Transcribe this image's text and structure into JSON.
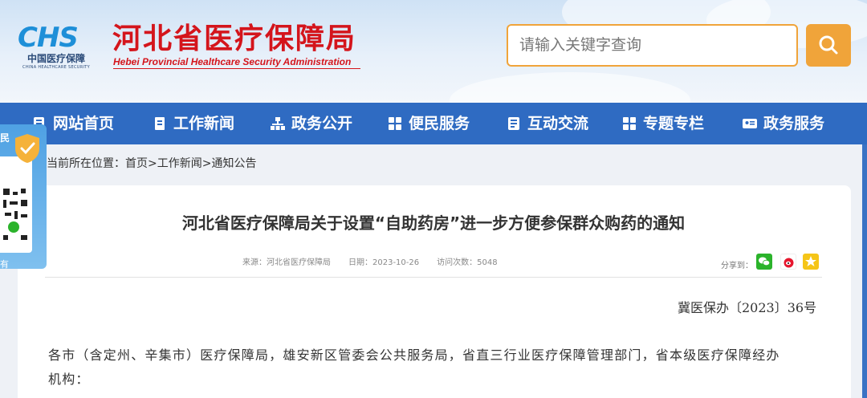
{
  "header": {
    "logo_letters": "CHS",
    "logo_cn": "中国医疗保障",
    "logo_en": "CHINA HEALTHCARE SECURITY",
    "site_title_cn": "河北省医疗保障局",
    "site_title_en": "Hebei Provincial Healthcare Security Administration",
    "search_placeholder": "请输入关键字查询",
    "search_icon": "search-icon"
  },
  "nav": {
    "items": [
      {
        "label": "网站首页",
        "icon": "book-icon"
      },
      {
        "label": "工作新闻",
        "icon": "bookmark-icon"
      },
      {
        "label": "政务公开",
        "icon": "sitemap-icon"
      },
      {
        "label": "便民服务",
        "icon": "grid-icon"
      },
      {
        "label": "互动交流",
        "icon": "document-icon"
      },
      {
        "label": "专题专栏",
        "icon": "grid-icon"
      },
      {
        "label": "政务服务",
        "icon": "id-card-icon"
      }
    ]
  },
  "breadcrumb": {
    "prefix": "当前所在位置：",
    "items": [
      "首页",
      "工作新闻",
      "通知公告"
    ],
    "separator": ">"
  },
  "article": {
    "title": "河北省医疗保障局关于设置“自助药房”进一步方便参保群众购药的通知",
    "source_label": "来源：",
    "source": "河北省医疗保障局",
    "date_label": "日期：",
    "date": "2023-10-26",
    "views_label": "访问次数：",
    "views": "5048",
    "share_label": "分享到：",
    "share_icons": [
      "wechat-icon",
      "weibo-icon",
      "qzone-icon"
    ],
    "doc_number": "冀医保办〔2023〕36号",
    "body_line1": "各市（含定州、辛集市）医疗保障局，雄安新区管委会公共服务局，省直三行业医疗保障管理部门，省本级医疗保障经办",
    "body_line2": "机构："
  },
  "qr_widget": {
    "top_label": "民",
    "bottom_label": "有"
  },
  "colors": {
    "accent_red": "#d4151c",
    "nav_blue": "#2f6bc2",
    "search_orange": "#f0a43a",
    "wechat_green": "#2bb32b",
    "weibo_red": "#e6162d",
    "qzone_yellow": "#f5c518"
  }
}
